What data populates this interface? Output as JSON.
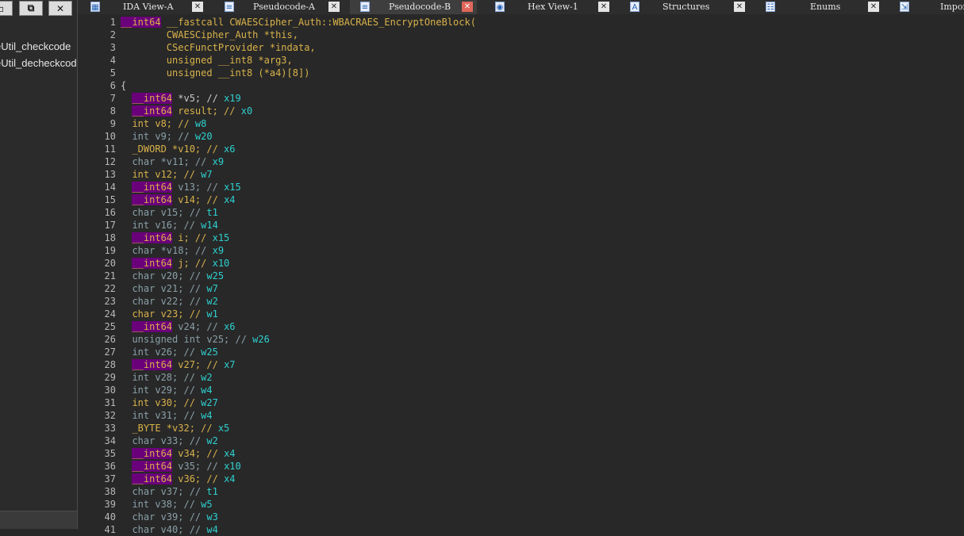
{
  "left_panel": {
    "functions": [
      "eUtil_checkcode",
      "eUtil_decheckcode"
    ]
  },
  "window_buttons": [
    "minimize",
    "restore",
    "close"
  ],
  "tabs": [
    {
      "label": "IDA View-A",
      "icon": "graph-icon",
      "active": false
    },
    {
      "label": "Pseudocode-A",
      "icon": "pseudocode-icon",
      "active": false
    },
    {
      "label": "Pseudocode-B",
      "icon": "pseudocode-icon",
      "active": true
    },
    {
      "label": "Hex View-1",
      "icon": "hex-icon",
      "active": false
    },
    {
      "label": "Structures",
      "icon": "structures-icon",
      "active": false
    },
    {
      "label": "Enums",
      "icon": "enums-icon",
      "active": false
    },
    {
      "label": "Impor",
      "icon": "imports-icon",
      "active": false
    }
  ],
  "code_lines": [
    [
      [
        "__int64",
        "pk"
      ],
      [
        " __fastcall CWAESCipher_Auth::WBACRAES_EncryptOneBlock(",
        "func"
      ]
    ],
    [
      [
        "        CWAESCipher_Auth *this,",
        "func"
      ]
    ],
    [
      [
        "        CSecFunctProvider *indata,",
        "func"
      ]
    ],
    [
      [
        "        unsigned __int8 *arg3,",
        "func"
      ]
    ],
    [
      [
        "        unsigned __int8 (*a4)[8])",
        "func"
      ]
    ],
    [
      [
        "{",
        "plain"
      ]
    ],
    [
      [
        "  ",
        "plain"
      ],
      [
        "__int64",
        "pk"
      ],
      [
        " *v5; // ",
        "com"
      ],
      [
        "x19",
        "reg"
      ]
    ],
    [
      [
        "  ",
        "plain"
      ],
      [
        "__int64",
        "pk"
      ],
      [
        " result; // ",
        "var"
      ],
      [
        "x0",
        "reg"
      ]
    ],
    [
      [
        "  int v8; // ",
        "kw"
      ],
      [
        "w8",
        "reg"
      ]
    ],
    [
      [
        "  int v9; // ",
        "kwd"
      ],
      [
        "w20",
        "reg"
      ]
    ],
    [
      [
        "  _DWORD *v10; // ",
        "kw"
      ],
      [
        "x6",
        "reg"
      ]
    ],
    [
      [
        "  char *v11; // ",
        "kwd"
      ],
      [
        "x9",
        "reg"
      ]
    ],
    [
      [
        "  int v12; // ",
        "kw"
      ],
      [
        "w7",
        "reg"
      ]
    ],
    [
      [
        "  ",
        "plain"
      ],
      [
        "__int64",
        "pk"
      ],
      [
        " v13; // ",
        "kwd"
      ],
      [
        "x15",
        "reg"
      ]
    ],
    [
      [
        "  ",
        "plain"
      ],
      [
        "__int64",
        "pk"
      ],
      [
        " v14; // ",
        "var"
      ],
      [
        "x4",
        "reg"
      ]
    ],
    [
      [
        "  char v15; // ",
        "kwd"
      ],
      [
        "t1",
        "reg"
      ]
    ],
    [
      [
        "  int v16; // ",
        "kwd"
      ],
      [
        "w14",
        "reg"
      ]
    ],
    [
      [
        "  ",
        "plain"
      ],
      [
        "__int64",
        "pk"
      ],
      [
        " i; // ",
        "var"
      ],
      [
        "x15",
        "reg"
      ]
    ],
    [
      [
        "  char *v18; // ",
        "kwd"
      ],
      [
        "x9",
        "reg"
      ]
    ],
    [
      [
        "  ",
        "plain"
      ],
      [
        "__int64",
        "pk"
      ],
      [
        " j; // ",
        "var"
      ],
      [
        "x10",
        "reg"
      ]
    ],
    [
      [
        "  char v20; // ",
        "kwd"
      ],
      [
        "w25",
        "reg"
      ]
    ],
    [
      [
        "  char v21; // ",
        "kwd"
      ],
      [
        "w7",
        "reg"
      ]
    ],
    [
      [
        "  char v22; // ",
        "kwd"
      ],
      [
        "w2",
        "reg"
      ]
    ],
    [
      [
        "  char v23; // ",
        "kw"
      ],
      [
        "w1",
        "reg"
      ]
    ],
    [
      [
        "  ",
        "plain"
      ],
      [
        "__int64",
        "pk"
      ],
      [
        " v24; // ",
        "kwd"
      ],
      [
        "x6",
        "reg"
      ]
    ],
    [
      [
        "  unsigned int v25; // ",
        "kwd"
      ],
      [
        "w26",
        "reg"
      ]
    ],
    [
      [
        "  int v26; // ",
        "kwd"
      ],
      [
        "w25",
        "reg"
      ]
    ],
    [
      [
        "  ",
        "plain"
      ],
      [
        "__int64",
        "pk"
      ],
      [
        " v27; // ",
        "var"
      ],
      [
        "x7",
        "reg"
      ]
    ],
    [
      [
        "  int v28; // ",
        "kwd"
      ],
      [
        "w2",
        "reg"
      ]
    ],
    [
      [
        "  int v29; // ",
        "kwd"
      ],
      [
        "w4",
        "reg"
      ]
    ],
    [
      [
        "  int v30; // ",
        "kw"
      ],
      [
        "w27",
        "reg"
      ]
    ],
    [
      [
        "  int v31; // ",
        "kwd"
      ],
      [
        "w4",
        "reg"
      ]
    ],
    [
      [
        "  _BYTE *v32; // ",
        "kw"
      ],
      [
        "x5",
        "reg"
      ]
    ],
    [
      [
        "  char v33; // ",
        "kwd"
      ],
      [
        "w2",
        "reg"
      ]
    ],
    [
      [
        "  ",
        "plain"
      ],
      [
        "__int64",
        "pk"
      ],
      [
        " v34; // ",
        "var"
      ],
      [
        "x4",
        "reg"
      ]
    ],
    [
      [
        "  ",
        "plain"
      ],
      [
        "__int64",
        "pk"
      ],
      [
        " v35; // ",
        "kwd"
      ],
      [
        "x10",
        "reg"
      ]
    ],
    [
      [
        "  ",
        "plain"
      ],
      [
        "__int64",
        "pk"
      ],
      [
        " v36; // ",
        "var"
      ],
      [
        "x4",
        "reg"
      ]
    ],
    [
      [
        "  char v37; // ",
        "kwd"
      ],
      [
        "t1",
        "reg"
      ]
    ],
    [
      [
        "  int v38; // ",
        "kwd"
      ],
      [
        "w5",
        "reg"
      ]
    ],
    [
      [
        "  char v39; // ",
        "kwd"
      ],
      [
        "w3",
        "reg"
      ]
    ],
    [
      [
        "  char v40; // ",
        "kwd"
      ],
      [
        "w4",
        "reg"
      ]
    ]
  ]
}
